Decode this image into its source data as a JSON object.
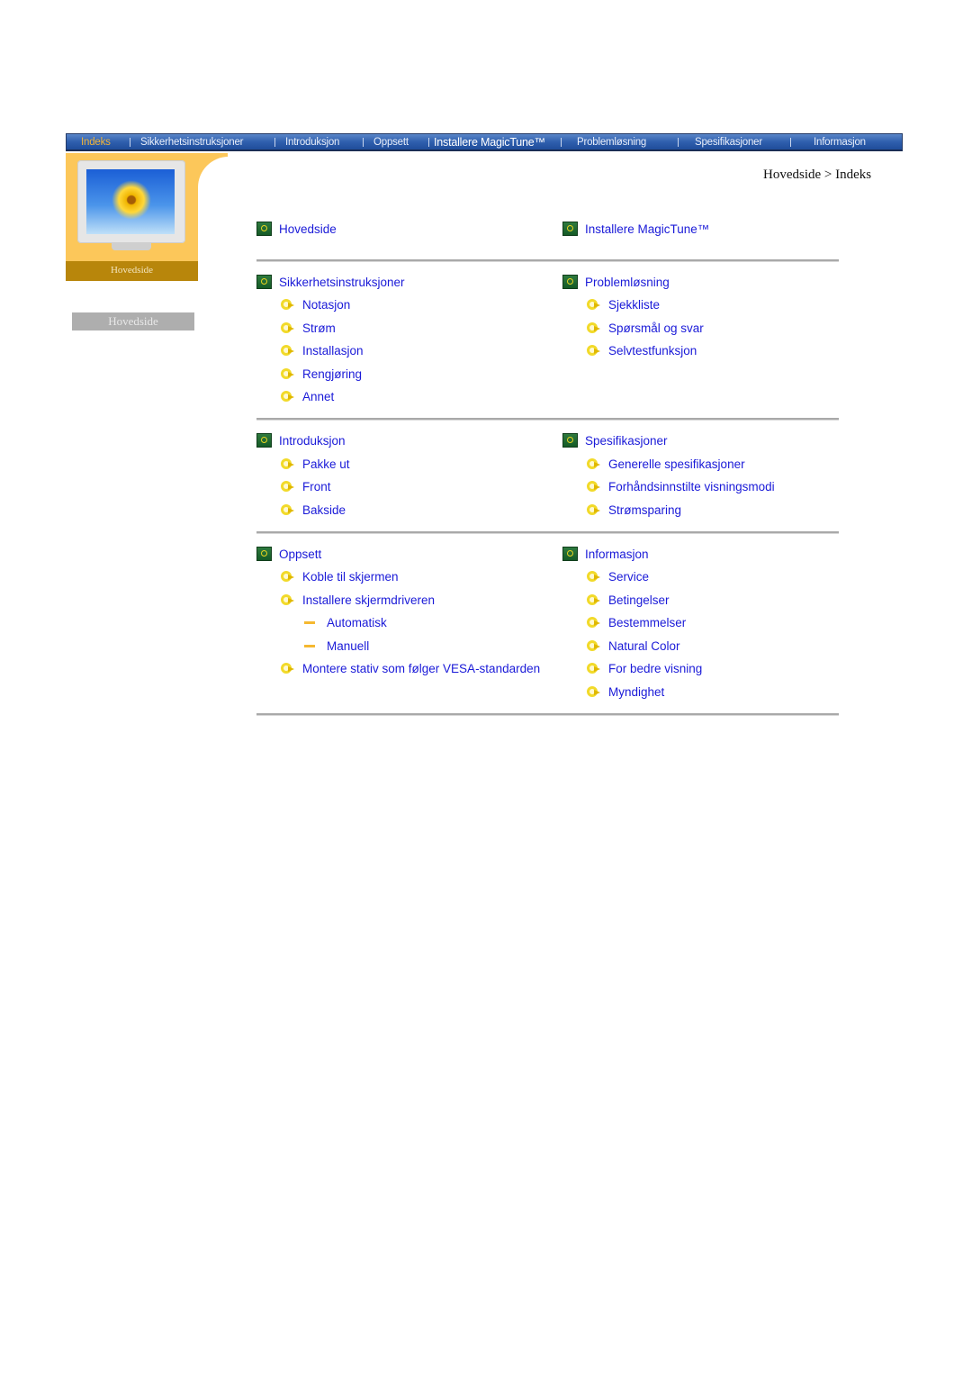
{
  "nav": {
    "items": [
      {
        "label": "Indeks",
        "active": true
      },
      {
        "label": "Sikkerhetsinstruksjoner"
      },
      {
        "label": "Introduksjon"
      },
      {
        "label": "Oppsett"
      },
      {
        "label": "Installere MagicTune™"
      },
      {
        "label": "Problemløsning"
      },
      {
        "label": "Spesifikasjoner"
      },
      {
        "label": "Informasjon"
      }
    ]
  },
  "sidebar": {
    "image_label": "Hovedside",
    "button_label": "Hovedside"
  },
  "breadcrumb": "Hovedside > Indeks",
  "index": {
    "hovedside": "Hovedside",
    "magictune": "Installere MagicTune™",
    "sikkerhet": {
      "title": "Sikkerhetsinstruksjoner",
      "items": [
        "Notasjon",
        "Strøm",
        "Installasjon",
        "Rengjøring",
        "Annet"
      ]
    },
    "problem": {
      "title": "Problemløsning",
      "items": [
        "Sjekkliste",
        "Spørsmål og svar",
        "Selvtestfunksjon"
      ]
    },
    "intro": {
      "title": "Introduksjon",
      "items": [
        "Pakke ut",
        "Front",
        "Bakside"
      ]
    },
    "spes": {
      "title": "Spesifikasjoner",
      "items": [
        "Generelle spesifikasjoner",
        "Forhåndsinnstilte visningsmodi",
        "Strømsparing"
      ]
    },
    "oppsett": {
      "title": "Oppsett",
      "items": [
        "Koble til skjermen",
        "Installere skjermdriveren",
        "Automatisk",
        "Manuell",
        "Montere stativ som følger VESA-standarden"
      ]
    },
    "info": {
      "title": "Informasjon",
      "items": [
        "Service",
        "Betingelser",
        "Bestemmelser",
        "Natural Color",
        "For bedre visning",
        "Myndighet"
      ]
    }
  }
}
